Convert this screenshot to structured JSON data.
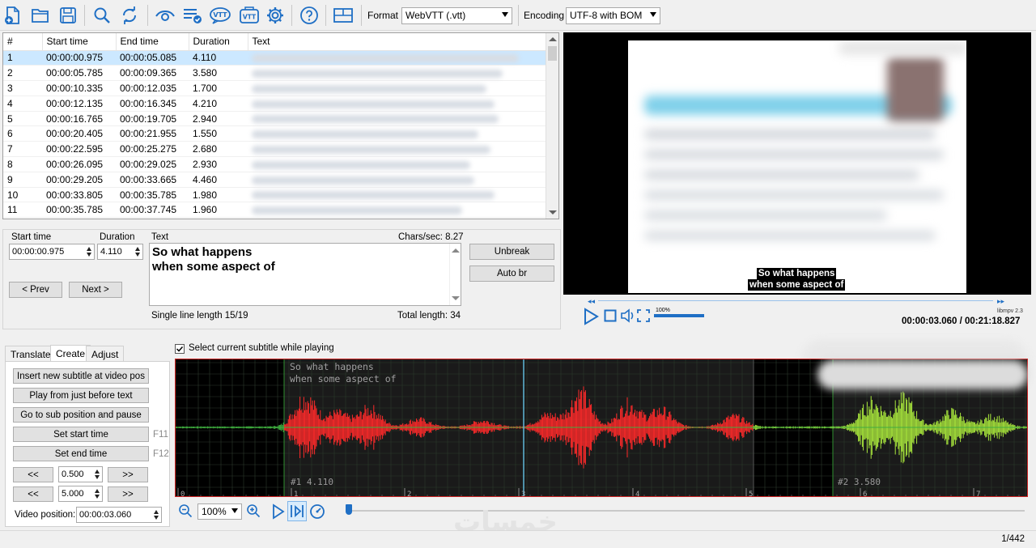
{
  "toolbar": {
    "format_label": "Format",
    "format_value": "WebVTT (.vtt)",
    "encoding_label": "Encoding",
    "encoding_value": "UTF-8 with BOM",
    "icons": [
      "new-file-icon",
      "open-folder-icon",
      "save-icon",
      "find-icon",
      "replace-icon",
      "visual-sync-icon",
      "spell-check-icon",
      "vtt-icon",
      "vtt-settings-icon",
      "settings-icon",
      "help-icon",
      "layout-icon"
    ]
  },
  "grid": {
    "headers": [
      "#",
      "Start time",
      "End time",
      "Duration",
      "Text"
    ],
    "rows": [
      {
        "num": "1",
        "start": "00:00:00.975",
        "end": "00:00:05.085",
        "duration": "4.110"
      },
      {
        "num": "2",
        "start": "00:00:05.785",
        "end": "00:00:09.365",
        "duration": "3.580"
      },
      {
        "num": "3",
        "start": "00:00:10.335",
        "end": "00:00:12.035",
        "duration": "1.700"
      },
      {
        "num": "4",
        "start": "00:00:12.135",
        "end": "00:00:16.345",
        "duration": "4.210"
      },
      {
        "num": "5",
        "start": "00:00:16.765",
        "end": "00:00:19.705",
        "duration": "2.940"
      },
      {
        "num": "6",
        "start": "00:00:20.405",
        "end": "00:00:21.955",
        "duration": "1.550"
      },
      {
        "num": "7",
        "start": "00:00:22.595",
        "end": "00:00:25.275",
        "duration": "2.680"
      },
      {
        "num": "8",
        "start": "00:00:26.095",
        "end": "00:00:29.025",
        "duration": "2.930"
      },
      {
        "num": "9",
        "start": "00:00:29.205",
        "end": "00:00:33.665",
        "duration": "4.460"
      },
      {
        "num": "10",
        "start": "00:00:33.805",
        "end": "00:00:35.785",
        "duration": "1.980"
      },
      {
        "num": "11",
        "start": "00:00:35.785",
        "end": "00:00:37.745",
        "duration": "1.960"
      }
    ]
  },
  "edit": {
    "start_time_label": "Start time",
    "start_time_value": "00:00:00.975",
    "duration_label": "Duration",
    "duration_value": "4.110",
    "text_label": "Text",
    "chars_per_sec": "Chars/sec: 8.27",
    "text_line1": "So what happens",
    "text_line2": "when some aspect of",
    "prev_label": "< Prev",
    "next_label": "Next >",
    "unbreak_label": "Unbreak",
    "auto_br_label": "Auto br",
    "single_line_length": "Single line length 15/19",
    "total_length": "Total length: 34"
  },
  "video": {
    "subtitle_line1": "So what happens",
    "subtitle_line2": "when some aspect of",
    "volume": "100%",
    "player_name": "libmpv 2.3",
    "time_display": "00:00:03.060 / 00:21:18.827"
  },
  "tabs": {
    "items": [
      "Translate",
      "Create",
      "Adjust"
    ],
    "active": "Create",
    "insert_label": "Insert new subtitle at video pos",
    "play_before_label": "Play from just before text",
    "goto_sub_label": "Go to sub position and pause",
    "set_start_label": "Set start time",
    "set_start_key": "F11",
    "set_end_label": "Set end time",
    "set_end_key": "F12",
    "back_label": "<<",
    "fwd_label": ">>",
    "step1_value": "0.500",
    "step2_value": "5.000",
    "video_position_label": "Video position:",
    "video_position_value": "00:00:03.060"
  },
  "waveform": {
    "select_while_playing_label": "Select current subtitle while playing",
    "select_while_playing_checked": true,
    "sub_text_line1": "So what happens",
    "sub_text_line2": "when some aspect of",
    "sub1_label": "#1  4.110",
    "sub2_label": "#2  3.580",
    "ticks": [
      "0",
      "1",
      "2",
      "3",
      "4",
      "5",
      "6",
      "7"
    ],
    "zoom_value": "100%"
  },
  "status": {
    "position": "1/442"
  },
  "watermark": "خمسات",
  "colors": {
    "selection": "#cce8ff",
    "wave_selected": "#ff2a2a",
    "wave_other": "#a8e63c",
    "accent_blue": "#1f6fc5"
  }
}
